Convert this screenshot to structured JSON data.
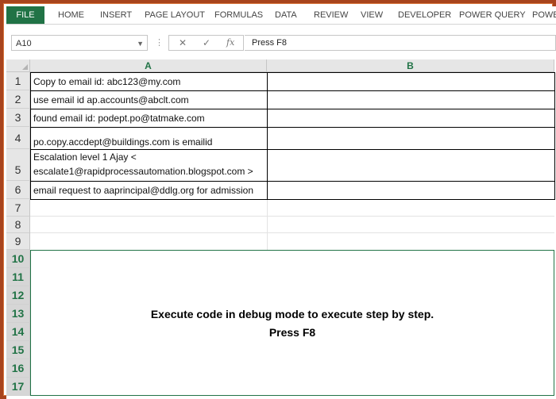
{
  "ribbon": {
    "tabs": [
      "FILE",
      "HOME",
      "INSERT",
      "PAGE LAYOUT",
      "FORMULAS",
      "DATA",
      "REVIEW",
      "VIEW",
      "DEVELOPER",
      "POWER QUERY",
      "POWE"
    ]
  },
  "formula_bar": {
    "name_box": "A10",
    "cancel_symbol": "✕",
    "enter_symbol": "✓",
    "fx_symbol": "fx",
    "content": "Press F8"
  },
  "sheet": {
    "columns": [
      "A",
      "B"
    ],
    "rows": [
      "1",
      "2",
      "3",
      "4",
      "5",
      "6",
      "7",
      "8",
      "9",
      "10",
      "11",
      "12",
      "13",
      "14",
      "15",
      "16",
      "17"
    ],
    "cells": {
      "A1": "Copy to email id: abc123@my.com",
      "A2": "use email id ap.accounts@abclt.com",
      "A3": "found email id: podept.po@tatmake.com",
      "A4": "po.copy.accdept@buildings.com is emailid",
      "A5_line1": "Escalation level 1 Ajay  <",
      "A5_line2": "escalate1@rapidprocessautomation.blogspot.com >",
      "A6": "email request to aaprincipal@ddlg.org for admission",
      "A10_line1": "Execute code in debug mode to execute step by step.",
      "A10_line2": "Press F8"
    }
  }
}
